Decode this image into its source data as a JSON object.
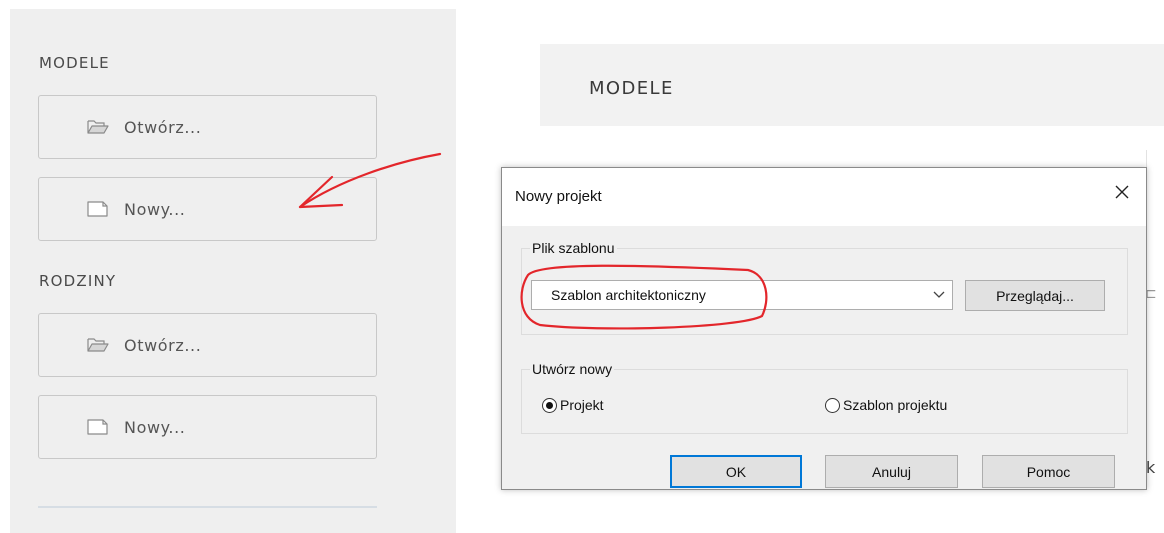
{
  "left_panel": {
    "models_title": "MODELE",
    "models_open_label": "Otwórz...",
    "models_new_label": "Nowy...",
    "families_title": "RODZINY",
    "families_open_label": "Otwórz...",
    "families_new_label": "Nowy..."
  },
  "right_background": {
    "header_title": "MODELE",
    "partial_text": "k"
  },
  "dialog": {
    "title": "Nowy projekt",
    "template_group_label": "Plik szablonu",
    "template_selected": "Szablon architektoniczny",
    "browse_label": "Przeglądaj...",
    "create_group_label": "Utwórz nowy",
    "radio_project_label": "Projekt",
    "radio_project_selected": true,
    "radio_template_label": "Szablon projektu",
    "radio_template_selected": false,
    "ok_label": "OK",
    "cancel_label": "Anuluj",
    "help_label": "Pomoc"
  },
  "icons": {
    "open": "folder-open-icon",
    "new": "new-file-icon",
    "close": "close-icon",
    "dropdown": "chevron-down-icon"
  },
  "colors": {
    "annotation_red": "#e3262b",
    "ok_focus_border": "#0078d7",
    "panel_background": "#efefef"
  }
}
